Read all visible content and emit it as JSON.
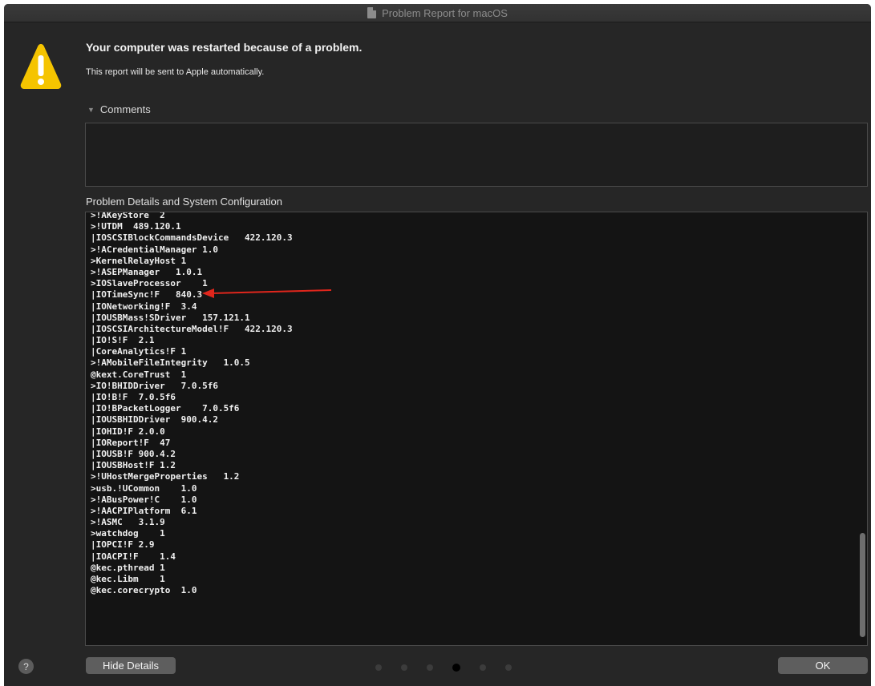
{
  "window": {
    "title": "Problem Report for macOS"
  },
  "header": {
    "heading": "Your computer was restarted because of a problem.",
    "subtext": "This report will be sent to Apple automatically."
  },
  "comments": {
    "label": "Comments",
    "value": ""
  },
  "details": {
    "label": "Problem Details and System Configuration",
    "lines": [
      ">!AKeyStore  2",
      ">!UTDM  489.120.1",
      "|IOSCSIBlockCommandsDevice   422.120.3",
      ">!ACredentialManager 1.0",
      ">KernelRelayHost 1",
      ">!ASEPManager   1.0.1",
      ">IOSlaveProcessor    1",
      "|IOTimeSync!F   840.3",
      "|IONetworking!F  3.4",
      "|IOUSBMass!SDriver   157.121.1",
      "|IOSCSIArchitectureModel!F   422.120.3",
      "|IO!S!F  2.1",
      "|CoreAnalytics!F 1",
      ">!AMobileFileIntegrity   1.0.5",
      "@kext.CoreTrust  1",
      ">IO!BHIDDriver   7.0.5f6",
      "|IO!B!F  7.0.5f6",
      "|IO!BPacketLogger    7.0.5f6",
      "|IOUSBHIDDriver  900.4.2",
      "|IOHID!F 2.0.0",
      "|IOReport!F  47",
      "|IOUSB!F 900.4.2",
      "|IOUSBHost!F 1.2",
      ">!UHostMergeProperties   1.2",
      ">usb.!UCommon    1.0",
      ">!ABusPower!C    1.0",
      ">!AACPIPlatform  6.1",
      ">!ASMC   3.1.9",
      ">watchdog    1",
      "|IOPCI!F 2.9",
      "|IOACPI!F    1.4",
      "@kec.pthread 1",
      "@kec.Libm    1",
      "@kec.corecrypto  1.0"
    ]
  },
  "footer": {
    "help_label": "?",
    "hide_details_label": "Hide Details",
    "ok_label": "OK",
    "page_dots": 6,
    "active_dot": 3
  },
  "colors": {
    "window_bg": "#262626",
    "warning_yellow": "#f5c400",
    "arrow_red": "#e0261c"
  },
  "icons": {
    "warning": "warning-triangle-icon",
    "document": "document-icon",
    "help": "help-icon"
  }
}
